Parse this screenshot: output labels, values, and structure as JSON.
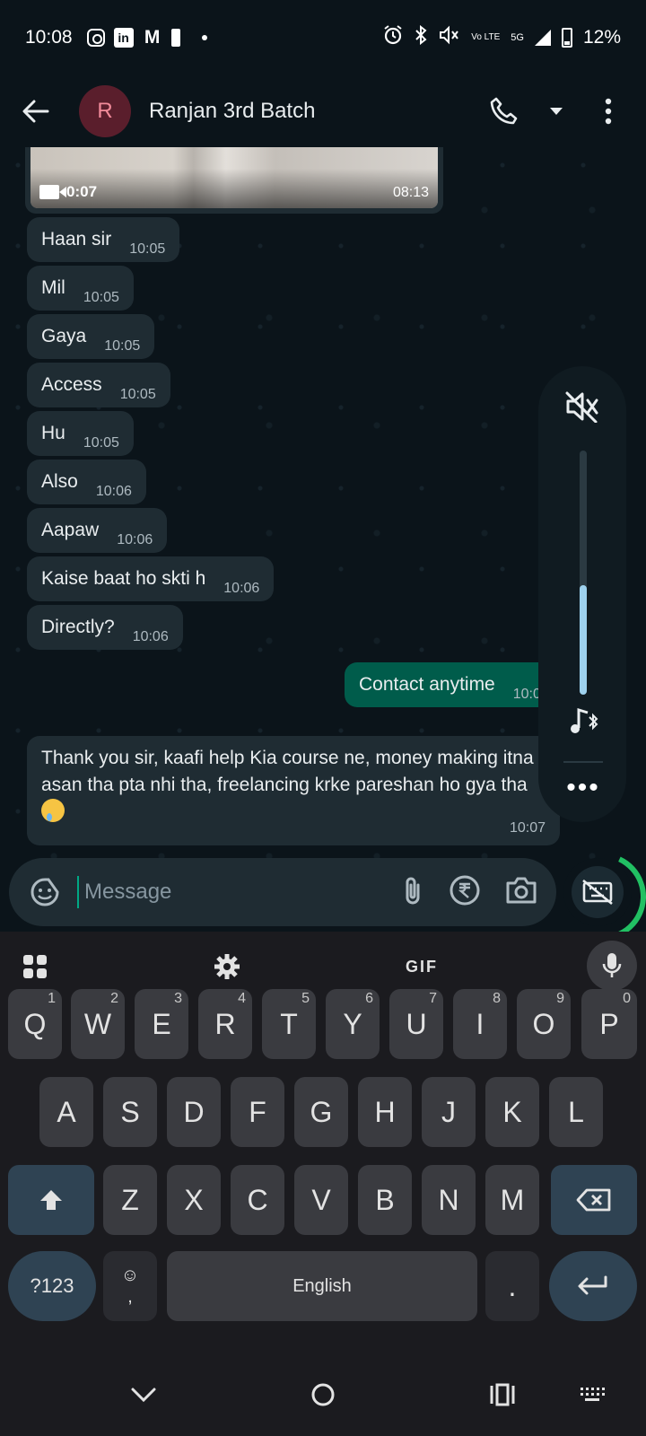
{
  "status_bar": {
    "time": "10:08",
    "lte_label": "Vo LTE",
    "network": "5G",
    "battery": "12%",
    "left_icons": [
      "instagram-icon",
      "linkedin-icon",
      "gmail-icon",
      "battery-saver-icon",
      "dot-icon"
    ],
    "right_icons": [
      "alarm-icon",
      "bluetooth-icon",
      "mute-icon",
      "volte-icon",
      "signal-5g-icon",
      "battery-icon"
    ]
  },
  "app_bar": {
    "avatar_letter": "R",
    "title": "Ranjan 3rd Batch",
    "actions": [
      "phone-icon",
      "dropdown-icon",
      "more-vertical-icon"
    ]
  },
  "media_message": {
    "duration": "0:07",
    "time": "08:13"
  },
  "messages": [
    {
      "text": "Haan sir",
      "time": "10:05",
      "direction": "in"
    },
    {
      "text": "Mil",
      "time": "10:05",
      "direction": "in"
    },
    {
      "text": "Gaya",
      "time": "10:05",
      "direction": "in"
    },
    {
      "text": "Access",
      "time": "10:05",
      "direction": "in"
    },
    {
      "text": "Hu",
      "time": "10:05",
      "direction": "in"
    },
    {
      "text": "Also",
      "time": "10:06",
      "direction": "in"
    },
    {
      "text": "Aapaw",
      "time": "10:06",
      "direction": "in"
    },
    {
      "text": "Kaise baat ho skti h",
      "time": "10:06",
      "direction": "in"
    },
    {
      "text": "Directly?",
      "time": "10:06",
      "direction": "in"
    },
    {
      "text": "Contact anytime",
      "time": "10:06",
      "direction": "out"
    },
    {
      "text": "Thank you sir, kaafi help Kia course ne, money making itna asan tha pta nhi tha, freelancing krke pareshan ho gya tha",
      "emoji": "crying-face-emoji",
      "time": "10:07",
      "direction": "in"
    }
  ],
  "volume_panel": {
    "level": 0.45,
    "icons": [
      "volume-mute-icon",
      "music-bluetooth-icon",
      "more-horizontal-icon"
    ],
    "more_label": "•••",
    "accent": "#9ed2ee"
  },
  "composer": {
    "placeholder": "Message",
    "icons": [
      "sticker-icon",
      "attach-icon",
      "rupee-payment-icon",
      "camera-icon",
      "keyboard-off-icon"
    ]
  },
  "keyboard": {
    "toolbar": {
      "gif_label": "GIF"
    },
    "row1": [
      {
        "k": "Q",
        "h": "1"
      },
      {
        "k": "W",
        "h": "2"
      },
      {
        "k": "E",
        "h": "3"
      },
      {
        "k": "R",
        "h": "4"
      },
      {
        "k": "T",
        "h": "5"
      },
      {
        "k": "Y",
        "h": "6"
      },
      {
        "k": "U",
        "h": "7"
      },
      {
        "k": "I",
        "h": "8"
      },
      {
        "k": "O",
        "h": "9"
      },
      {
        "k": "P",
        "h": "0"
      }
    ],
    "row2": [
      "A",
      "S",
      "D",
      "F",
      "G",
      "H",
      "J",
      "K",
      "L"
    ],
    "row3": [
      "Z",
      "X",
      "C",
      "V",
      "B",
      "N",
      "M"
    ],
    "symbols_label": "?123",
    "emoji_key": {
      "top": "☺",
      "bottom": ","
    },
    "space_label": "English",
    "period_label": "."
  },
  "colors": {
    "background": "#0b141a",
    "incoming_bubble": "#1f2c33",
    "outgoing_bubble": "#005c4b",
    "accent_green": "#21c063"
  }
}
